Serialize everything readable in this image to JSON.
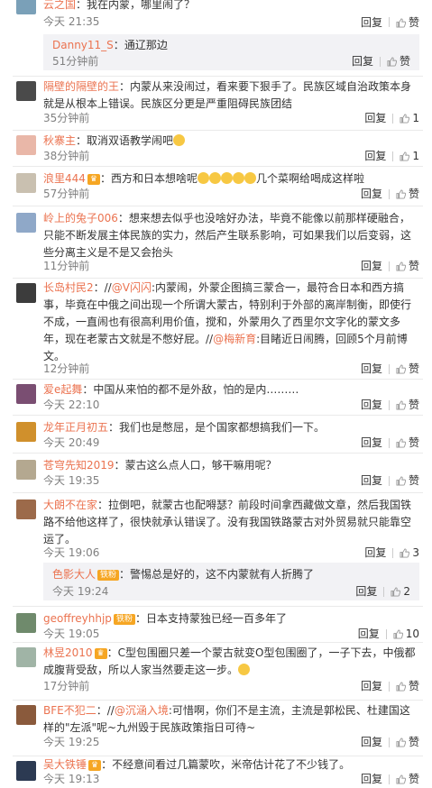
{
  "ui": {
    "reply": "回复",
    "like": "赞"
  },
  "c0": {
    "user": "云之国",
    "sep": "：",
    "text": "我在内蒙，哪里闹了？",
    "time": "今天 21:35",
    "sub": {
      "user": "Danny11_S",
      "sep": "：",
      "text": "通辽那边",
      "time": "51分钟前"
    }
  },
  "c1": {
    "user": "隔壁的隔壁的王",
    "sep": "：",
    "text": "内蒙从来没闹过，看来要下狠手了。民族区域自治政策本身就是从根本上错误。民族区分更是严重阻碍民族团结",
    "time": "35分钟前",
    "likes": "1"
  },
  "c2": {
    "user": "秋寨主",
    "sep": "：",
    "text": "取消双语教学闹吧",
    "time": "38分钟前",
    "likes": "1",
    "emoji": "smirk-face-emoji"
  },
  "c3": {
    "user": "浪里444",
    "sep": "：",
    "text": "西方和日本想啥呢",
    "text2": "几个菜啊给喝成这样啦",
    "time": "57分钟前",
    "emoji": "laughing-emoji x5"
  },
  "c4": {
    "user": "岭上的兔子006",
    "sep": "：",
    "text": "想来想去似乎也没啥好办法，毕竟不能像以前那样硬融合，只能不断发展主体民族的实力，然后产生联系影响，可如果我们以后变弱，这些分离主义是不是又会抬头",
    "time": "11分钟前"
  },
  "c5": {
    "user": "长岛村民2",
    "sep": "：//",
    "m1": "@V闪闪",
    "text": ":内蒙闹，外蒙企图搞三蒙合一，最符合日本和西方搞事，毕竟在中俄之间出现一个所谓大蒙古，特别利于外部的离岸制衡，即使行不成，一直闹也有很高利用价值，搅和，外蒙用久了西里尔文字化的蒙文多年，现在老蒙古文就是不憋好屁。//",
    "m2": "@梅新育",
    "text2": ":目睹近日闹腾，回顾5个月前博文。",
    "time": "12分钟前"
  },
  "c6": {
    "user": "爱e起舞",
    "sep": "：",
    "text": "中国从来怕的都不是外敌，怕的是内………",
    "time": "今天 22:10"
  },
  "c7": {
    "user": "龙年正月初五",
    "sep": "：",
    "text": "我们也是憋屈，是个国家都想搞我们一下。",
    "time": "今天 20:49"
  },
  "c8": {
    "user": "苍穹先知2019",
    "sep": "：",
    "text": "蒙古这么点人口，够干嘛用呢？",
    "time": "今天 19:35"
  },
  "c9": {
    "user": "大朗不在家",
    "sep": "：",
    "text": "拉倒吧，就蒙古也配嘚瑟？前段时间拿西藏做文章，然后我国铁路不给他这样了，很快就承认错误了。没有我国铁路蒙古对外贸易就只能靠空运了。",
    "time": "今天 19:06",
    "likes": "3",
    "sub": {
      "user": "色影大人",
      "sep": "：",
      "text": "警惕总是好的，这不内蒙就有人折腾了",
      "time": "今天 19:24",
      "likes": "2"
    }
  },
  "c10": {
    "user": "geoffreyhhjp",
    "sep": "：",
    "text": "日本支持蒙独已经一百多年了",
    "time": "今天 19:05",
    "likes": "10"
  },
  "c11": {
    "user": "林昱2010",
    "sep": "：",
    "text": "C型包围圈只差一个蒙古就变O型包围圈了，一子下去，中俄都成腹背受敌，所以人家当然要走这一步。",
    "time": "17分钟前",
    "emoji": "sad-face-emoji"
  },
  "c12": {
    "user": "BFE不犯二",
    "sep": "：//",
    "m1": "@沉涵入境",
    "text": ":可惜啊，你们不是主流，主流是郭松民、杜建国这样的\"左派\"呢~九州毁于民族政策指日可待~",
    "time": "今天 19:25"
  },
  "c13": {
    "user": "吴大铁锤",
    "sep": "：",
    "text": "不经意间看过几篇蒙吹，米帝估计花了不少钱了。",
    "time": "今天 19:13"
  },
  "badge": "铁粉"
}
